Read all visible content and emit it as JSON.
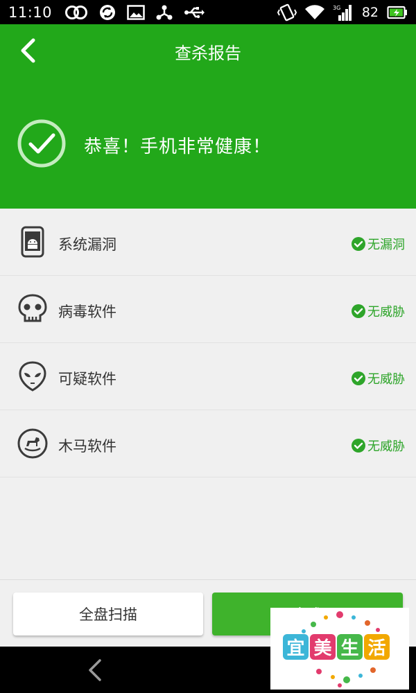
{
  "status_bar": {
    "time": "11:10",
    "battery_level": "82",
    "network_label": "3G"
  },
  "header": {
    "title": "查杀报告",
    "health_message": "恭喜！手机非常健康！"
  },
  "scan_items": [
    {
      "name": "系统漏洞",
      "status": "无漏洞",
      "icon": "phone-android-icon"
    },
    {
      "name": "病毒软件",
      "status": "无威胁",
      "icon": "skull-icon"
    },
    {
      "name": "可疑软件",
      "status": "无威胁",
      "icon": "alien-icon"
    },
    {
      "name": "木马软件",
      "status": "无威胁",
      "icon": "rocking-horse-icon"
    }
  ],
  "buttons": {
    "full_scan": "全盘扫描",
    "done": "完成"
  },
  "watermark": {
    "chars": [
      "宜",
      "美",
      "生",
      "活"
    ]
  },
  "colors": {
    "header_green": "#22a81a",
    "status_green": "#2ea52a",
    "done_button": "#3fb32c"
  }
}
